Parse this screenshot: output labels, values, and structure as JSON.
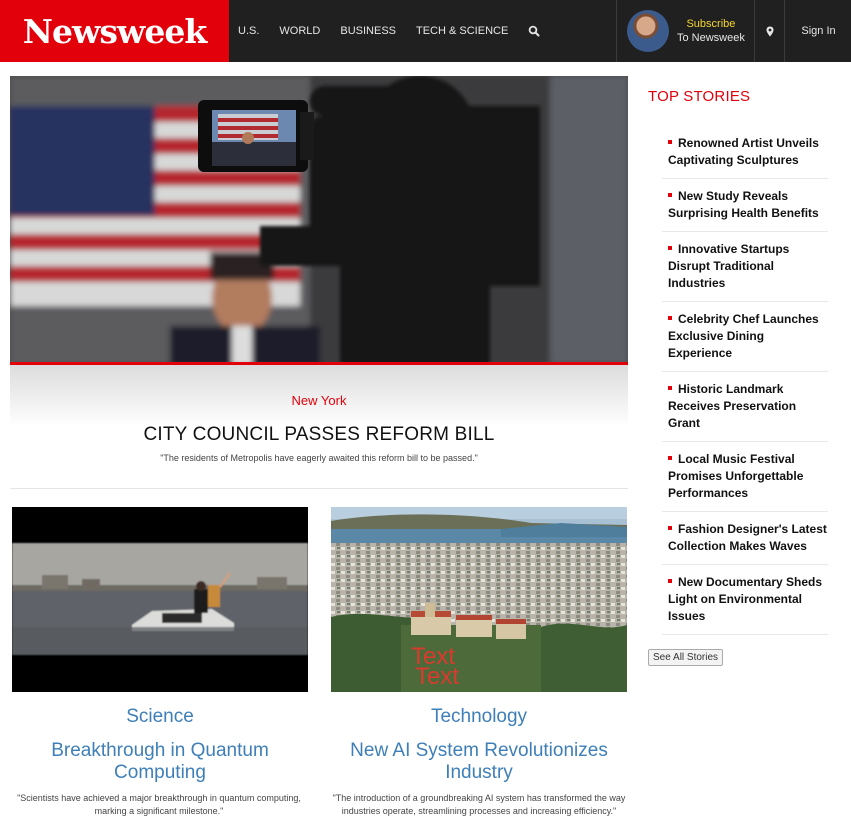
{
  "brand": {
    "logo_text": "Newsweek",
    "color_brand": "#e2000b",
    "color_topbar": "#202020"
  },
  "nav": {
    "items": [
      "U.S.",
      "WORLD",
      "BUSINESS",
      "TECH & SCIENCE"
    ],
    "search_icon": "search-icon"
  },
  "subscribe": {
    "line1": "Subscribe",
    "line2": "To Newsweek",
    "accent": "#f6d72b"
  },
  "location_icon": "map-marker-icon",
  "sign_in": "Sign In",
  "hero": {
    "kicker": "New York",
    "title": "CITY COUNCIL PASSES REFORM BILL",
    "description": "\"The residents of Metropolis have eagerly awaited this reform bill to be passed.\""
  },
  "cards": [
    {
      "category": "Science",
      "title": "Breakthrough in Quantum Computing",
      "description": "\"Scientists have achieved a major breakthrough in quantum computing, marking a significant milestone.\""
    },
    {
      "category": "Technology",
      "title": "New AI System Revolutionizes Industry",
      "description": "\"The introduction of a groundbreaking AI system has transformed the way industries operate, streamlining processes and increasing efficiency.\"",
      "image_overlay_text": "Text"
    }
  ],
  "top_stories": {
    "heading": "TOP STORIES",
    "items": [
      "Renowned Artist Unveils Captivating Sculptures",
      "New Study Reveals Surprising Health Benefits",
      "Innovative Startups Disrupt Traditional Industries",
      "Celebrity Chef Launches Exclusive Dining Experience",
      "Historic Landmark Receives Preservation Grant",
      "Local Music Festival Promises Unforgettable Performances",
      "Fashion Designer's Latest Collection Makes Waves",
      "New Documentary Sheds Light on Environmental Issues"
    ],
    "see_all": "See All Stories"
  },
  "link_color": "#3e7fb8"
}
